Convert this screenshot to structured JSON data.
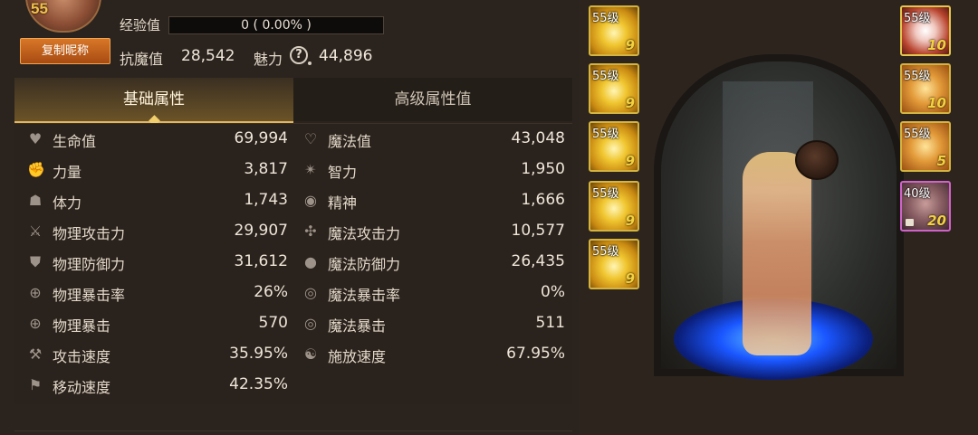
{
  "profile": {
    "level": "55",
    "copy_name_button": "复制昵称",
    "exp_label": "经验值",
    "exp_text": "0 ( 0.00% )",
    "exp_percent": 0,
    "resist_label": "抗魔值",
    "resist_value": "28,542",
    "charm_label": "魅力",
    "charm_value": "44,896"
  },
  "tabs": [
    {
      "label": "基础属性",
      "active": true
    },
    {
      "label": "高级属性值",
      "active": false
    }
  ],
  "stats_left": [
    {
      "icon": "heart-icon",
      "label": "生命值",
      "value": "69,994"
    },
    {
      "icon": "fist-icon",
      "label": "力量",
      "value": "3,817"
    },
    {
      "icon": "body-icon",
      "label": "体力",
      "value": "1,743"
    },
    {
      "icon": "sword-icon",
      "label": "物理攻击力",
      "value": "29,907"
    },
    {
      "icon": "shield-icon",
      "label": "物理防御力",
      "value": "31,612"
    },
    {
      "icon": "crosshair-icon",
      "label": "物理暴击率",
      "value": "26%"
    },
    {
      "icon": "crosshair-icon",
      "label": "物理暴击",
      "value": "570"
    },
    {
      "icon": "attack-speed-icon",
      "label": "攻击速度",
      "value": "35.95%"
    },
    {
      "icon": "boot-icon",
      "label": "移动速度",
      "value": "42.35%"
    }
  ],
  "stats_right": [
    {
      "icon": "heart-outline-icon",
      "label": "魔法值",
      "value": "43,048"
    },
    {
      "icon": "intellect-icon",
      "label": "智力",
      "value": "1,950"
    },
    {
      "icon": "spirit-icon",
      "label": "精神",
      "value": "1,666"
    },
    {
      "icon": "magic-attack-icon",
      "label": "魔法攻击力",
      "value": "10,577"
    },
    {
      "icon": "magic-defense-icon",
      "label": "魔法防御力",
      "value": "26,435"
    },
    {
      "icon": "magic-crit-icon",
      "label": "魔法暴击率",
      "value": "0%"
    },
    {
      "icon": "magic-crit-icon",
      "label": "魔法暴击",
      "value": "511"
    },
    {
      "icon": "cast-speed-icon",
      "label": "施放速度",
      "value": "67.95%"
    }
  ],
  "equipment_left": [
    {
      "level": "55级",
      "num": "9"
    },
    {
      "level": "55级",
      "num": "9"
    },
    {
      "level": "55级",
      "num": "9"
    },
    {
      "level": "55级",
      "num": "9"
    },
    {
      "level": "55级",
      "num": "9"
    }
  ],
  "equipment_right": [
    {
      "level": "55级",
      "num": "10"
    },
    {
      "level": "55级",
      "num": "10"
    },
    {
      "level": "55级",
      "num": "5"
    },
    {
      "level": "40级",
      "num": "20"
    }
  ]
}
